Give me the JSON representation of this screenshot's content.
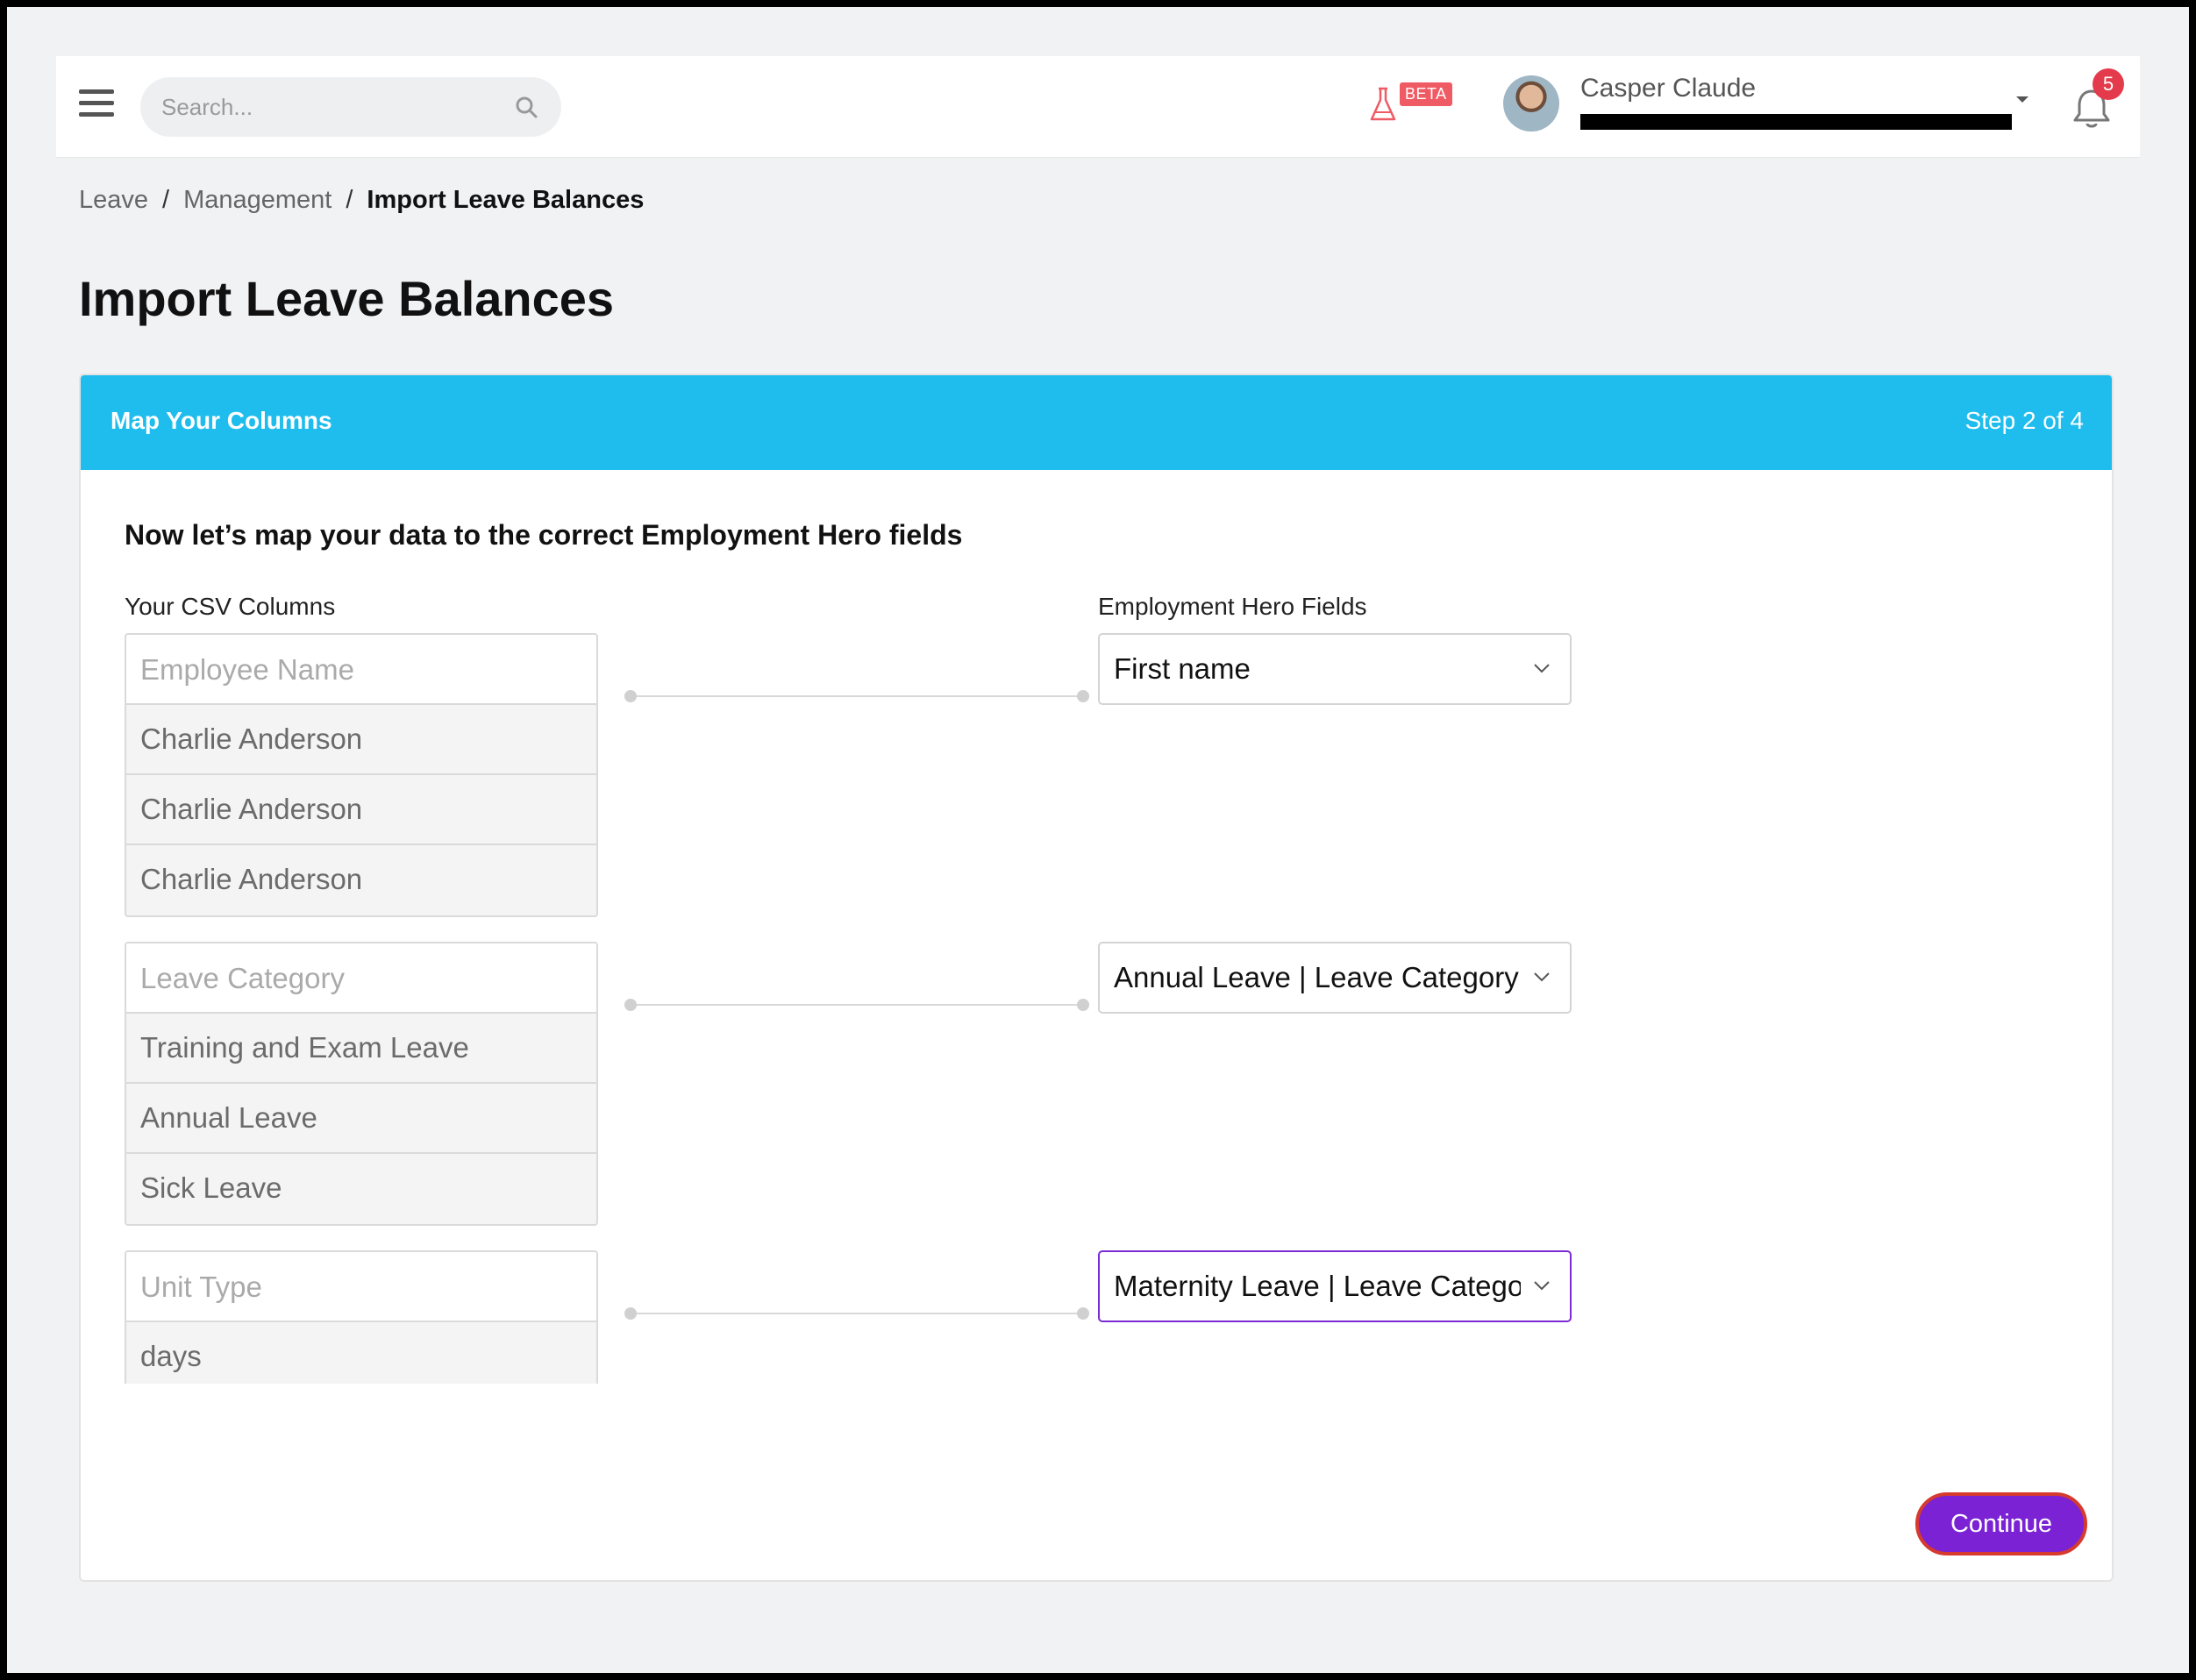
{
  "header": {
    "search_placeholder": "Search...",
    "beta_label": "BETA",
    "user_name": "Casper Claude",
    "notification_count": "5"
  },
  "breadcrumb": [
    "Leave",
    "Management",
    "Import Leave Balances"
  ],
  "page_title": "Import Leave Balances",
  "card": {
    "title": "Map Your Columns",
    "step": "Step 2 of 4",
    "instructions": "Now let’s map your data to the correct Employment Hero fields",
    "left_label": "Your CSV Columns",
    "right_label": "Employment Hero Fields"
  },
  "mappings": [
    {
      "csv_header": "Employee Name",
      "values": [
        "Charlie Anderson",
        "Charlie Anderson",
        "Charlie Anderson"
      ],
      "field": "First name"
    },
    {
      "csv_header": "Leave Category",
      "values": [
        "Training and Exam Leave",
        "Annual Leave",
        "Sick Leave"
      ],
      "field": "Annual Leave | Leave Category"
    },
    {
      "csv_header": "Unit Type",
      "values": [
        "days"
      ],
      "field": "Maternity Leave | Leave Category"
    }
  ],
  "continue_label": "Continue",
  "colors": {
    "header_blue": "#1fbded",
    "primary_purple": "#7a22d4",
    "badge_red": "#e33b4b"
  }
}
